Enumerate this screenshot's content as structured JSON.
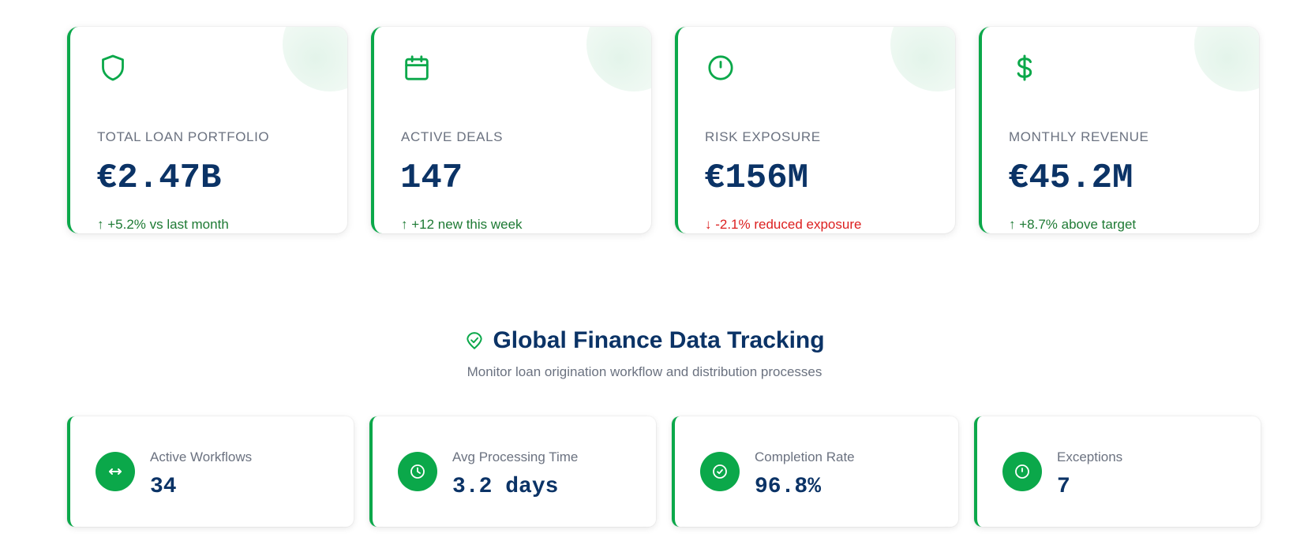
{
  "kpis": [
    {
      "icon": "shield-icon",
      "label": "TOTAL LOAN PORTFOLIO",
      "value": "€2.47B",
      "trend": "↑ +5.2% vs last month",
      "direction": "up"
    },
    {
      "icon": "calendar-icon",
      "label": "ACTIVE DEALS",
      "value": "147",
      "trend": "↑ +12 new this week",
      "direction": "up"
    },
    {
      "icon": "alert-circle-icon",
      "label": "RISK EXPOSURE",
      "value": "€156M",
      "trend": "↓ -2.1% reduced exposure",
      "direction": "down"
    },
    {
      "icon": "dollar-icon",
      "label": "MONTHLY REVENUE",
      "value": "€45.2M",
      "trend": "↑ +8.7% above target",
      "direction": "up"
    }
  ],
  "section": {
    "icon": "location-pin-icon",
    "title": "Global Finance Data Tracking",
    "subtitle": "Monitor loan origination workflow and distribution processes"
  },
  "workflow_stats": [
    {
      "icon": "arrows-horizontal-icon",
      "label": "Active Workflows",
      "value": "34"
    },
    {
      "icon": "clock-icon",
      "label": "Avg Processing Time",
      "value": "3.2 days"
    },
    {
      "icon": "check-circle-icon",
      "label": "Completion Rate",
      "value": "96.8%"
    },
    {
      "icon": "alert-circle-icon",
      "label": "Exceptions",
      "value": "7"
    }
  ],
  "colors": {
    "accent": "#0ba84a",
    "navy": "#0b3366",
    "muted": "#6b7280",
    "trend_up": "#1e7a34",
    "trend_down": "#dc1f1f"
  }
}
